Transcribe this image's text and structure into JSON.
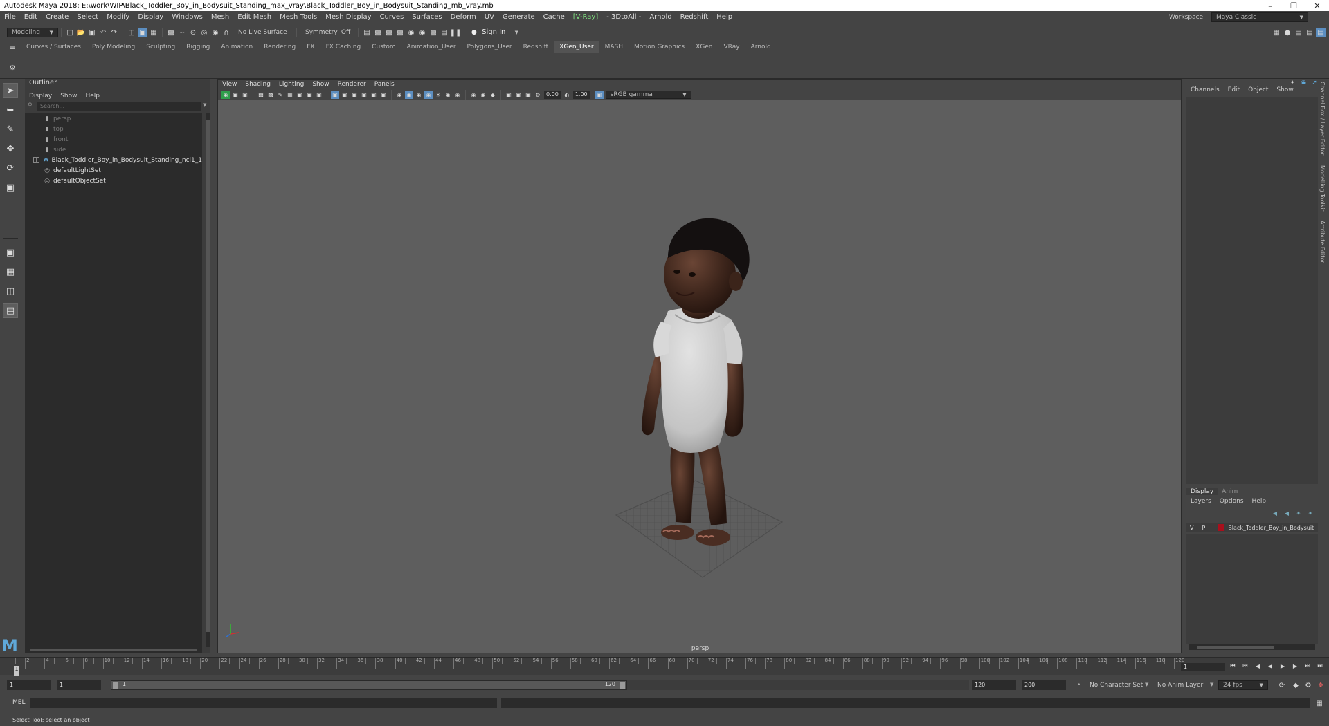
{
  "window": {
    "title": "Autodesk Maya 2018: E:\\work\\WIP\\Black_Toddler_Boy_in_Bodysuit_Standing_max_vray\\Black_Toddler_Boy_in_Bodysuit_Standing_mb_vray.mb"
  },
  "menubar": {
    "items": [
      "File",
      "Edit",
      "Create",
      "Select",
      "Modify",
      "Display",
      "Windows",
      "Mesh",
      "Edit Mesh",
      "Mesh Tools",
      "Mesh Display",
      "Curves",
      "Surfaces",
      "Deform",
      "UV",
      "Generate",
      "Cache",
      "[V-Ray]",
      "- 3DtoAll -",
      "Arnold",
      "Redshift",
      "Help"
    ],
    "workspace_label": "Workspace :",
    "workspace_value": "Maya Classic"
  },
  "statusline": {
    "mode": "Modeling",
    "live_surface": "No Live Surface",
    "symmetry": "Symmetry: Off",
    "sign_in": "Sign In"
  },
  "shelf": {
    "tabs": [
      "Curves / Surfaces",
      "Poly Modeling",
      "Sculpting",
      "Rigging",
      "Animation",
      "Rendering",
      "FX",
      "FX Caching",
      "Custom",
      "Animation_User",
      "Polygons_User",
      "Redshift",
      "XGen_User",
      "MASH",
      "Motion Graphics",
      "XGen",
      "VRay",
      "Arnold"
    ],
    "active_tab": "XGen_User"
  },
  "outliner": {
    "title": "Outliner",
    "menu": [
      "Display",
      "Show",
      "Help"
    ],
    "search_placeholder": "Search...",
    "items": [
      {
        "label": "persp",
        "icon": "camera-icon",
        "dim": true
      },
      {
        "label": "top",
        "icon": "camera-icon",
        "dim": true
      },
      {
        "label": "front",
        "icon": "camera-icon",
        "dim": true
      },
      {
        "label": "side",
        "icon": "camera-icon",
        "dim": true
      },
      {
        "label": "Black_Toddler_Boy_in_Bodysuit_Standing_ncl1_1",
        "icon": "transform-icon",
        "dim": false
      },
      {
        "label": "defaultLightSet",
        "icon": "set-icon",
        "dim": false
      },
      {
        "label": "defaultObjectSet",
        "icon": "set-icon",
        "dim": false
      }
    ]
  },
  "viewport": {
    "menu": [
      "View",
      "Shading",
      "Lighting",
      "Show",
      "Renderer",
      "Panels"
    ],
    "exposure": "0.00",
    "gamma": "1.00",
    "color_space": "sRGB gamma",
    "camera_label": "persp"
  },
  "channelbox": {
    "menu": [
      "Channels",
      "Edit",
      "Object",
      "Show"
    ],
    "side_tabs": [
      "Channel Box / Layer Editor",
      "Modelling Toolkit",
      "Attribute Editor"
    ]
  },
  "layereditor": {
    "tabs": [
      "Display",
      "Anim"
    ],
    "active_tab": "Display",
    "menu": [
      "Layers",
      "Options",
      "Help"
    ],
    "layer": {
      "v": "V",
      "p": "P",
      "name": "Black_Toddler_Boy_in_Bodysuit",
      "color": "#a80f1c"
    }
  },
  "timeslider": {
    "current_frame": "1",
    "frame_field": "1",
    "tick_labels": [
      "2",
      "4",
      "6",
      "8",
      "10",
      "12",
      "14",
      "16",
      "18",
      "20",
      "22",
      "24",
      "26",
      "28",
      "30",
      "32",
      "34",
      "36",
      "38",
      "40",
      "42",
      "44",
      "46",
      "48",
      "50",
      "52",
      "54",
      "56",
      "58",
      "60",
      "62",
      "64",
      "66",
      "68",
      "70",
      "72",
      "74",
      "76",
      "78",
      "80",
      "82",
      "84",
      "86",
      "88",
      "90",
      "92",
      "94",
      "96",
      "98",
      "100",
      "102",
      "104",
      "106",
      "108",
      "110",
      "112",
      "114",
      "116",
      "118",
      "120"
    ]
  },
  "rangeslider": {
    "start": "1",
    "start_inner": "1",
    "range_start_label": "1",
    "range_end_label": "120",
    "end": "120",
    "end_outer": "200",
    "character_set": "No Character Set",
    "anim_layer": "No Anim Layer",
    "fps": "24 fps"
  },
  "cmdline": {
    "label": "MEL"
  },
  "helpline": {
    "text": "Select Tool: select an object"
  }
}
